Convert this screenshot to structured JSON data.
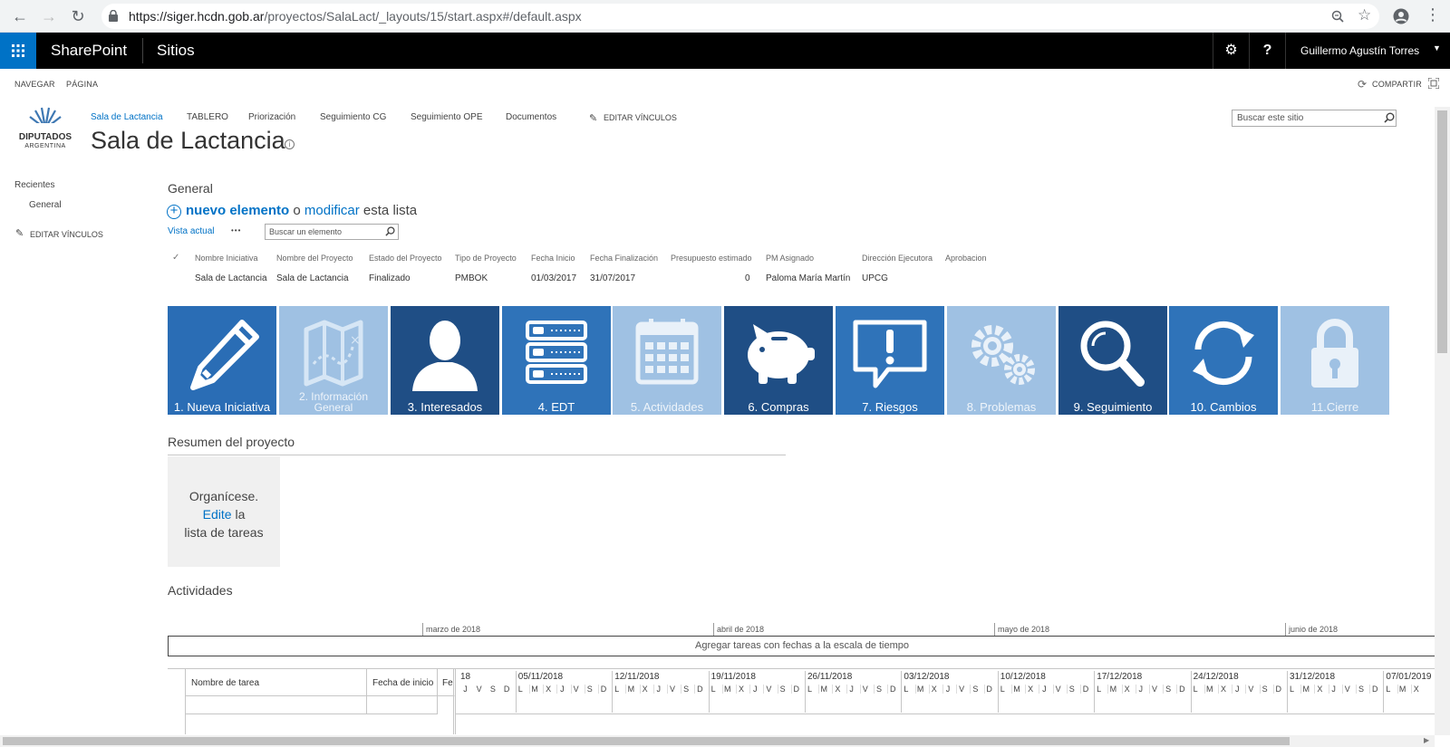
{
  "browser": {
    "url_host": "https://siger.hcdn.gob.ar",
    "url_path": "/proyectos/SalaLact/_layouts/15/start.aspx#/default.aspx"
  },
  "suite": {
    "app_name": "SharePoint",
    "sites_label": "Sitios",
    "help_label": "?",
    "user_name": "Guillermo Agustín Torres"
  },
  "ribbon": {
    "navegar": "NAVEGAR",
    "pagina": "PÁGINA",
    "compartir": "COMPARTIR"
  },
  "logo": {
    "line1": "DIPUTADOS",
    "line2": "ARGENTINA"
  },
  "topnav": {
    "items": [
      "Sala de Lactancia",
      "TABLERO",
      "Priorización",
      "Seguimiento CG",
      "Seguimiento OPE",
      "Documentos"
    ],
    "edit_links": "EDITAR VÍNCULOS",
    "search_placeholder": "Buscar este sitio"
  },
  "site_title": "Sala de Lactancia",
  "leftnav": {
    "recientes": "Recientes",
    "general": "General",
    "edit_links": "EDITAR VÍNCULOS"
  },
  "general_list": {
    "title": "General",
    "new_item": "nuevo elemento",
    "o": "o",
    "modify": "modificar",
    "this_list": "esta lista",
    "view": "Vista actual",
    "more": "•••",
    "search_placeholder": "Buscar un elemento",
    "columns": [
      "Nombre Iniciativa",
      "Nombre del Proyecto",
      "Estado del Proyecto",
      "Tipo de Proyecto",
      "Fecha Inicio",
      "Fecha Finalización",
      "Presupuesto estimado",
      "PM Asignado",
      "Dirección Ejecutora",
      "Aprobacion"
    ],
    "row": [
      "Sala de Lactancia",
      "Sala de Lactancia",
      "Finalizado",
      "PMBOK",
      "01/03/2017",
      "31/07/2017",
      "0",
      "Paloma María Martín",
      "UPCG",
      ""
    ]
  },
  "tiles": [
    {
      "label": "1. Nueva Iniciativa",
      "icon": "pencil-icon",
      "color": "#2a6db5"
    },
    {
      "label": "2. Información General",
      "icon": "map-icon",
      "color": "#9fc1e3"
    },
    {
      "label": "3. Interesados",
      "icon": "person-icon",
      "color": "#1f4e85"
    },
    {
      "label": "4. EDT",
      "icon": "server-icon",
      "color": "#2f73b9"
    },
    {
      "label": "5. Actividades",
      "icon": "calendar-icon",
      "color": "#9fc1e3"
    },
    {
      "label": "6. Compras",
      "icon": "piggy-bank-icon",
      "color": "#1f4e85"
    },
    {
      "label": "7. Riesgos",
      "icon": "alert-bubble-icon",
      "color": "#2f73b9"
    },
    {
      "label": "8. Problemas",
      "icon": "gears-icon",
      "color": "#9fc1e3"
    },
    {
      "label": "9. Seguimiento",
      "icon": "magnifier-icon",
      "color": "#1f4e85"
    },
    {
      "label": "10. Cambios",
      "icon": "refresh-icon",
      "color": "#2f73b9"
    },
    {
      "label": "11.Cierre",
      "icon": "lock-icon",
      "color": "#9fc1e3"
    }
  ],
  "summary": {
    "title": "Resumen del proyecto",
    "line1": "Organícese.",
    "edit": "Edite",
    "la": "la",
    "line3": "lista de tareas"
  },
  "activities": {
    "title": "Actividades",
    "months": [
      "marzo de 2018",
      "abril de 2018",
      "mayo de 2018",
      "junio de 2018"
    ],
    "add_tasks": "Agregar tareas con fechas a la escala de tiempo",
    "task_name_col": "Nombre de tarea",
    "start_col": "Fecha de inicio",
    "fe_col": "Fe",
    "partial_week": "18",
    "weeks": [
      "05/11/2018",
      "12/11/2018",
      "19/11/2018",
      "26/11/2018",
      "03/12/2018",
      "10/12/2018",
      "17/12/2018",
      "24/12/2018",
      "31/12/2018",
      "07/01/2019"
    ],
    "partial_days": [
      "J",
      "V",
      "S",
      "D"
    ],
    "days": [
      "L",
      "M",
      "X",
      "J",
      "V",
      "S",
      "D"
    ]
  },
  "colors": {
    "suite_bg": "#000000",
    "waffle": "#0072c6",
    "link": "#0072c6"
  }
}
